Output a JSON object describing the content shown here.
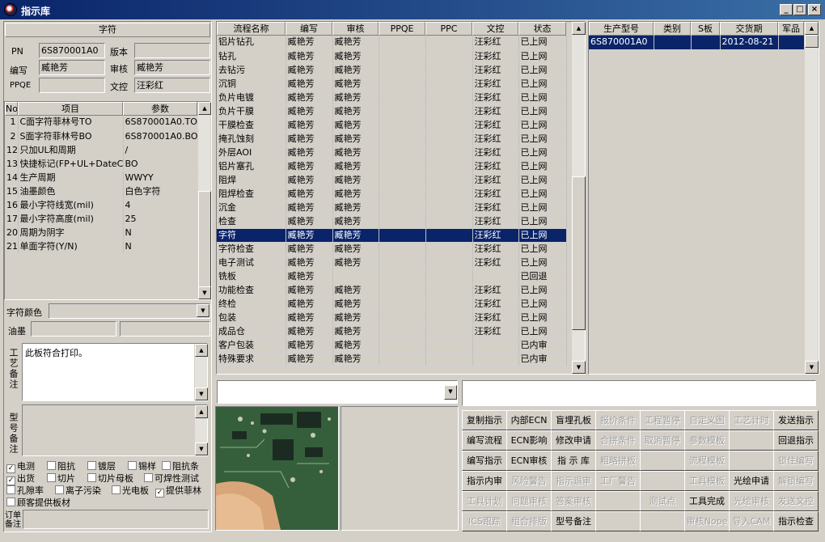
{
  "window": {
    "title": "指示库",
    "min": "_",
    "max": "□",
    "close": "×"
  },
  "char_panel": {
    "title": "字符",
    "pn_label": "PN",
    "pn": "6S870001A0",
    "version_label": "版本",
    "version": "",
    "writer_label": "编写",
    "writer": "臧艳芳",
    "review_label": "审核",
    "review": "臧艳芳",
    "ppqe_label": "PPQE",
    "ppqe": "",
    "doc_label": "文控",
    "doc": "汪彩红"
  },
  "params": {
    "headers": [
      "No",
      "项目",
      "参数"
    ],
    "rows": [
      {
        "no": "1",
        "item": "C面字符菲林号TO",
        "value": "6S870001A0.TO"
      },
      {
        "no": "2",
        "item": "S面字符菲林号BO",
        "value": "6S870001A0.BO"
      },
      {
        "no": "12",
        "item": "只加UL和周期",
        "value": "/"
      },
      {
        "no": "13",
        "item": "快捷标记(FP+UL+DateCo",
        "value": "BO"
      },
      {
        "no": "14",
        "item": "生产周期",
        "value": "WWYY"
      },
      {
        "no": "15",
        "item": "油墨颜色",
        "value": "白色字符"
      },
      {
        "no": "16",
        "item": "最小字符线宽(mil)",
        "value": "4"
      },
      {
        "no": "17",
        "item": "最小字符高度(mil)",
        "value": "25"
      },
      {
        "no": "20",
        "item": "周期为阴字",
        "value": "N"
      },
      {
        "no": "21",
        "item": "单面字符(Y/N)",
        "value": "N"
      }
    ]
  },
  "char_color_label": "字符颜色",
  "ink_label": "油墨",
  "process_note_label": "工艺备注",
  "process_note": "此板符合打印。",
  "model_note_label": "型号备注",
  "order_note_label": "订单备注",
  "checks": [
    {
      "label": "电测",
      "checked": true
    },
    {
      "label": "阻抗",
      "checked": false
    },
    {
      "label": "镀层",
      "checked": false
    },
    {
      "label": "锡样",
      "checked": false
    },
    {
      "label": "阻抗条",
      "checked": false
    },
    {
      "label": "出货",
      "checked": true
    },
    {
      "label": "切片",
      "checked": false
    },
    {
      "label": "切片母板",
      "checked": false
    },
    {
      "label": "可焊性测试",
      "checked": false
    },
    {
      "label": "孔隙率",
      "checked": false
    },
    {
      "label": "离子污染",
      "checked": false
    },
    {
      "label": "光电板",
      "checked": false
    },
    {
      "label": "提供菲林",
      "checked": true
    },
    {
      "label": "顾客提供板材",
      "checked": false
    }
  ],
  "flow": {
    "headers": [
      "流程名称",
      "编写",
      "审核",
      "PPQE",
      "PPC",
      "文控",
      "状态"
    ],
    "rows": [
      [
        "铝片钻孔",
        "臧艳芳",
        "臧艳芳",
        "",
        "",
        "汪彩红",
        "已上网"
      ],
      [
        "钻孔",
        "臧艳芳",
        "臧艳芳",
        "",
        "",
        "汪彩红",
        "已上网"
      ],
      [
        "去钻污",
        "臧艳芳",
        "臧艳芳",
        "",
        "",
        "汪彩红",
        "已上网"
      ],
      [
        "沉铜",
        "臧艳芳",
        "臧艳芳",
        "",
        "",
        "汪彩红",
        "已上网"
      ],
      [
        "负片电镀",
        "臧艳芳",
        "臧艳芳",
        "",
        "",
        "汪彩红",
        "已上网"
      ],
      [
        "负片干膜",
        "臧艳芳",
        "臧艳芳",
        "",
        "",
        "汪彩红",
        "已上网"
      ],
      [
        "干膜检查",
        "臧艳芳",
        "臧艳芳",
        "",
        "",
        "汪彩红",
        "已上网"
      ],
      [
        "掩孔蚀刻",
        "臧艳芳",
        "臧艳芳",
        "",
        "",
        "汪彩红",
        "已上网"
      ],
      [
        "外层AOI",
        "臧艳芳",
        "臧艳芳",
        "",
        "",
        "汪彩红",
        "已上网"
      ],
      [
        "铝片塞孔",
        "臧艳芳",
        "臧艳芳",
        "",
        "",
        "汪彩红",
        "已上网"
      ],
      [
        "阻焊",
        "臧艳芳",
        "臧艳芳",
        "",
        "",
        "汪彩红",
        "已上网"
      ],
      [
        "阻焊检查",
        "臧艳芳",
        "臧艳芳",
        "",
        "",
        "汪彩红",
        "已上网"
      ],
      [
        "沉金",
        "臧艳芳",
        "臧艳芳",
        "",
        "",
        "汪彩红",
        "已上网"
      ],
      [
        "检查",
        "臧艳芳",
        "臧艳芳",
        "",
        "",
        "汪彩红",
        "已上网"
      ],
      [
        "字符",
        "臧艳芳",
        "臧艳芳",
        "",
        "",
        "汪彩红",
        "已上网"
      ],
      [
        "字符检查",
        "臧艳芳",
        "臧艳芳",
        "",
        "",
        "汪彩红",
        "已上网"
      ],
      [
        "电子测试",
        "臧艳芳",
        "臧艳芳",
        "",
        "",
        "汪彩红",
        "已上网"
      ],
      [
        "铣板",
        "臧艳芳",
        "",
        "",
        "",
        "",
        "已回退"
      ],
      [
        "功能检查",
        "臧艳芳",
        "臧艳芳",
        "",
        "",
        "汪彩红",
        "已上网"
      ],
      [
        "终检",
        "臧艳芳",
        "臧艳芳",
        "",
        "",
        "汪彩红",
        "已上网"
      ],
      [
        "包装",
        "臧艳芳",
        "臧艳芳",
        "",
        "",
        "汪彩红",
        "已上网"
      ],
      [
        "成品仓",
        "臧艳芳",
        "臧艳芳",
        "",
        "",
        "汪彩红",
        "已上网"
      ],
      [
        "客户包装",
        "臧艳芳",
        "臧艳芳",
        "",
        "",
        "",
        "已内审"
      ],
      [
        "特殊要求",
        "臧艳芳",
        "臧艳芳",
        "",
        "",
        "",
        "已内审"
      ]
    ],
    "selected": 14
  },
  "orders": {
    "headers": [
      "生产型号",
      "类别",
      "S板",
      "交货期",
      "军品"
    ],
    "rows": [
      [
        "6S870001A0",
        "",
        "",
        "2012-08-21",
        ""
      ]
    ]
  },
  "buttons": [
    [
      {
        "label": "复制指示",
        "enabled": true
      },
      {
        "label": "内部ECN",
        "enabled": true
      },
      {
        "label": "盲埋孔板",
        "enabled": true
      },
      {
        "label": "报价条件",
        "enabled": false
      },
      {
        "label": "工程暂停",
        "enabled": false
      },
      {
        "label": "自定义图",
        "enabled": false
      },
      {
        "label": "工艺计时",
        "enabled": false
      },
      {
        "label": "发送指示",
        "enabled": true
      }
    ],
    [
      {
        "label": "编写流程",
        "enabled": true
      },
      {
        "label": "ECN影响",
        "enabled": true
      },
      {
        "label": "修改申请",
        "enabled": true
      },
      {
        "label": "合拼条件",
        "enabled": false
      },
      {
        "label": "取消暂停",
        "enabled": false
      },
      {
        "label": "参数模板",
        "enabled": false
      },
      {
        "label": "",
        "enabled": false
      },
      {
        "label": "回退指示",
        "enabled": true
      }
    ],
    [
      {
        "label": "编写指示",
        "enabled": true
      },
      {
        "label": "ECN审核",
        "enabled": true
      },
      {
        "label": "指 示 库",
        "enabled": true
      },
      {
        "label": "粗略拼板",
        "enabled": false
      },
      {
        "label": "",
        "enabled": false
      },
      {
        "label": "流程模板",
        "enabled": false
      },
      {
        "label": "",
        "enabled": false
      },
      {
        "label": "锁住编写",
        "enabled": false
      }
    ],
    [
      {
        "label": "指示内审",
        "enabled": true
      },
      {
        "label": "风险警告",
        "enabled": false
      },
      {
        "label": "指示退审",
        "enabled": false
      },
      {
        "label": "工厂警告",
        "enabled": false
      },
      {
        "label": "",
        "enabled": false
      },
      {
        "label": "工具模板",
        "enabled": false
      },
      {
        "label": "光绘申请",
        "enabled": true
      },
      {
        "label": "解锁编写",
        "enabled": false
      }
    ],
    [
      {
        "label": "工具计划",
        "enabled": false
      },
      {
        "label": "问题审核",
        "enabled": false
      },
      {
        "label": "答案审核",
        "enabled": false
      },
      {
        "label": "",
        "enabled": false
      },
      {
        "label": "测试点",
        "enabled": false
      },
      {
        "label": "工具完成",
        "enabled": true
      },
      {
        "label": "光绘审核",
        "enabled": false
      },
      {
        "label": "发送文控",
        "enabled": false
      }
    ],
    [
      {
        "label": "ICS跟踪",
        "enabled": false
      },
      {
        "label": "组合排版",
        "enabled": false
      },
      {
        "label": "型号备注",
        "enabled": true
      },
      {
        "label": "",
        "enabled": false
      },
      {
        "label": "",
        "enabled": false
      },
      {
        "label": "审核Nope",
        "enabled": false
      },
      {
        "label": "导入CAM",
        "enabled": false
      },
      {
        "label": "指示检查",
        "enabled": true
      }
    ]
  ]
}
